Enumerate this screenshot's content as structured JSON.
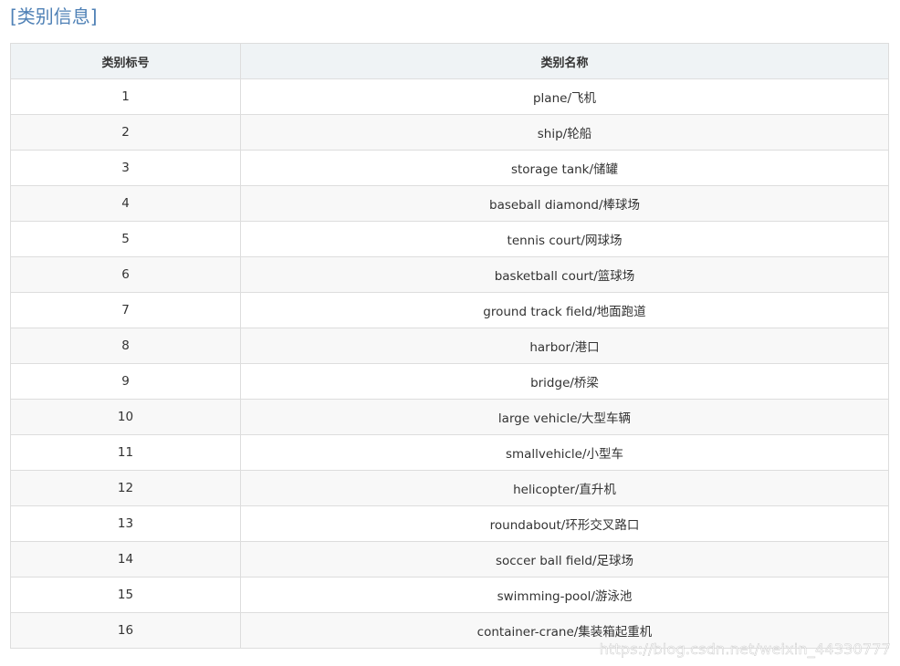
{
  "heading": "[类别信息]",
  "table": {
    "headers": [
      "类别标号",
      "类别名称"
    ],
    "rows": [
      {
        "id": "1",
        "name": "plane/飞机"
      },
      {
        "id": "2",
        "name": "ship/轮船"
      },
      {
        "id": "3",
        "name": "storage tank/储罐"
      },
      {
        "id": "4",
        "name": "baseball diamond/棒球场"
      },
      {
        "id": "5",
        "name": "tennis court/网球场"
      },
      {
        "id": "6",
        "name": "basketball court/篮球场"
      },
      {
        "id": "7",
        "name": "ground track field/地面跑道"
      },
      {
        "id": "8",
        "name": "harbor/港口"
      },
      {
        "id": "9",
        "name": "bridge/桥梁"
      },
      {
        "id": "10",
        "name": "large vehicle/大型车辆"
      },
      {
        "id": "11",
        "name": "smallvehicle/小型车"
      },
      {
        "id": "12",
        "name": "helicopter/直升机"
      },
      {
        "id": "13",
        "name": "roundabout/环形交叉路口"
      },
      {
        "id": "14",
        "name": "soccer ball field/足球场"
      },
      {
        "id": "15",
        "name": "swimming-pool/游泳池"
      },
      {
        "id": "16",
        "name": "container-crane/集装箱起重机"
      }
    ]
  },
  "watermark": "https://blog.csdn.net/weixin_44330777",
  "colors": {
    "heading": "#4f81b6",
    "header_bg": "#eff3f5",
    "row_alt_bg": "#f8f8f8",
    "border": "#dddddd",
    "text": "#333333"
  }
}
